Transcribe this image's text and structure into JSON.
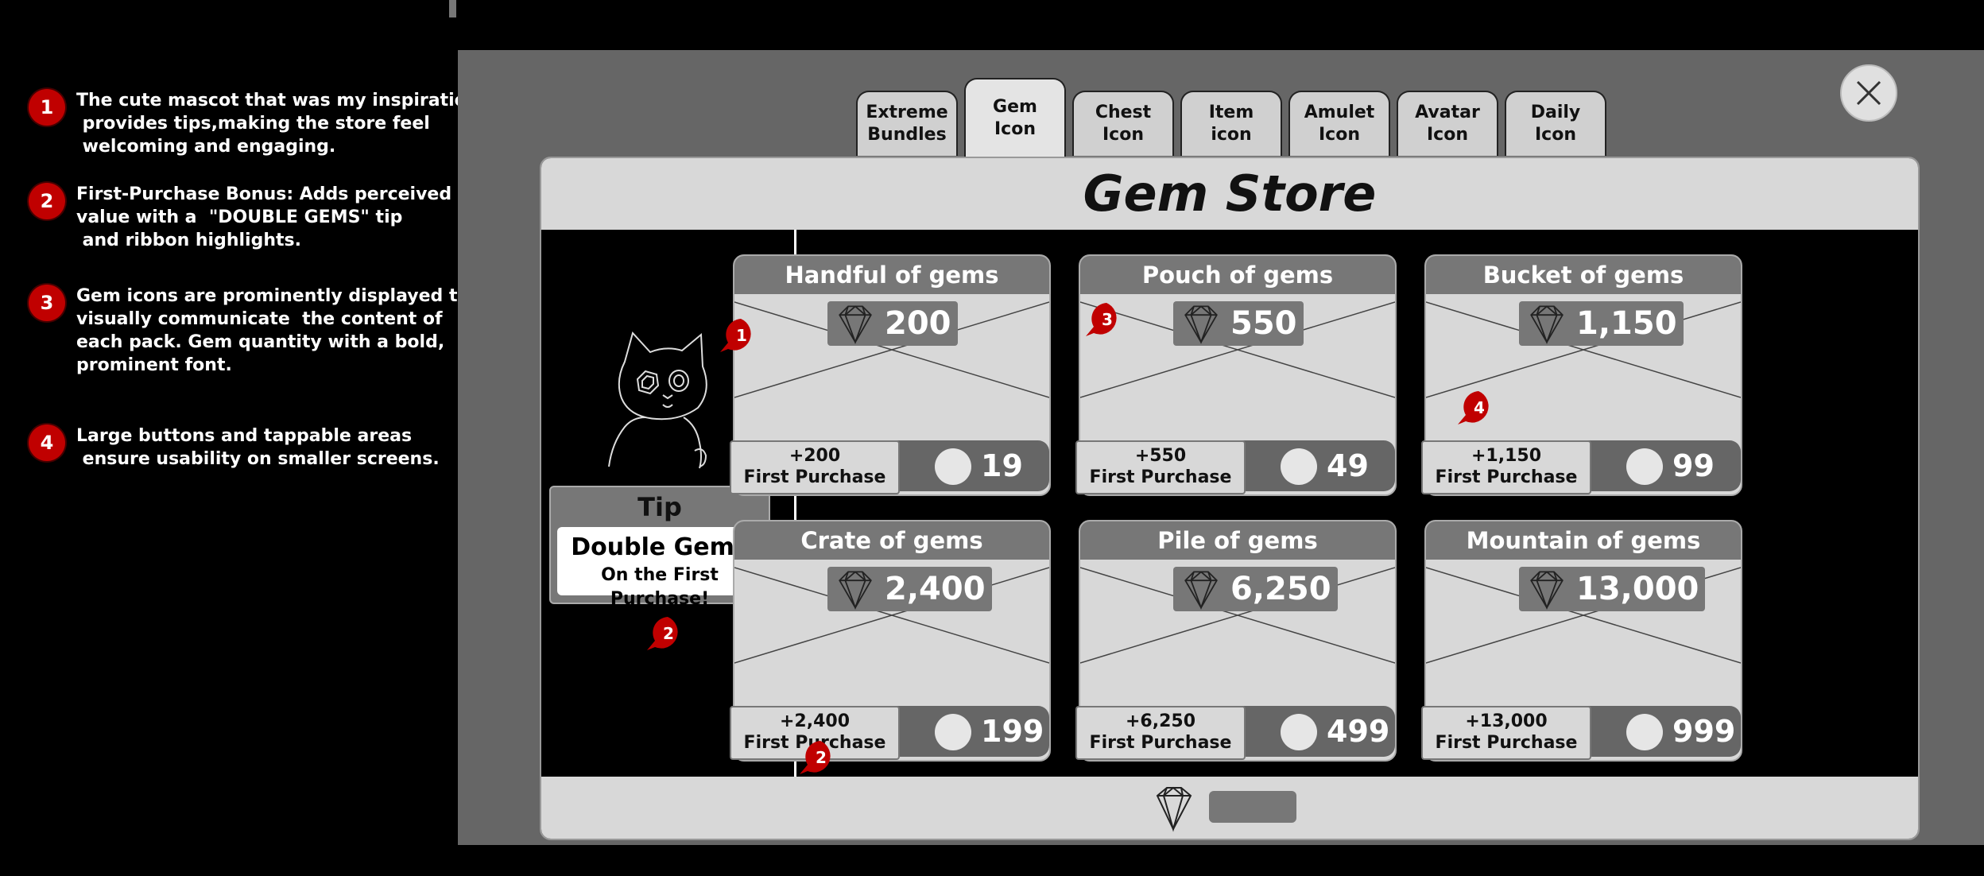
{
  "annotations": [
    {
      "num": "1",
      "text": "The cute mascot that was my inspiration,\n provides tips,making the store feel\n welcoming and engaging."
    },
    {
      "num": "2",
      "text": "First-Purchase Bonus: Adds perceived\nvalue with a  \"DOUBLE GEMS\" tip\n and ribbon highlights."
    },
    {
      "num": "3",
      "text": "Gem icons are prominently displayed to\nvisually communicate  the content of\neach pack. Gem quantity with a bold,\nprominent font."
    },
    {
      "num": "4",
      "text": "Large buttons and tappable areas\n ensure usability on smaller screens."
    }
  ],
  "tabs": [
    {
      "label": "Extreme\nBundles",
      "active": false
    },
    {
      "label": "Gem\nIcon",
      "active": true
    },
    {
      "label": "Chest\nIcon",
      "active": false
    },
    {
      "label": "Item\nicon",
      "active": false
    },
    {
      "label": "Amulet\nIcon",
      "active": false
    },
    {
      "label": "Avatar\nIcon",
      "active": false
    },
    {
      "label": "Daily\nIcon",
      "active": false
    }
  ],
  "store": {
    "title": "Gem Store"
  },
  "tip": {
    "title": "Tip",
    "line1": "Double  Gems",
    "line2": "On the First Purchase!"
  },
  "packs": [
    {
      "name": "Handful of gems",
      "gems": "200",
      "bonus": "+200",
      "bonus_label": "First Purchase",
      "price": "19"
    },
    {
      "name": "Pouch of gems",
      "gems": "550",
      "bonus": "+550",
      "bonus_label": "First Purchase",
      "price": "49"
    },
    {
      "name": "Bucket of gems",
      "gems": "1,150",
      "bonus": "+1,150",
      "bonus_label": "First Purchase",
      "price": "99"
    },
    {
      "name": "Crate of gems",
      "gems": "2,400",
      "bonus": "+2,400",
      "bonus_label": "First Purchase",
      "price": "199"
    },
    {
      "name": "Pile of gems",
      "gems": "6,250",
      "bonus": "+6,250",
      "bonus_label": "First Purchase",
      "price": "499"
    },
    {
      "name": "Mountain of gems",
      "gems": "13,000",
      "bonus": "+13,000",
      "bonus_label": "First Purchase",
      "price": "999"
    }
  ],
  "markers": [
    "1",
    "2",
    "3",
    "4",
    "2"
  ],
  "colors": {
    "accent_red": "#c00000",
    "panel_gray": "#666666",
    "card_gray": "#d8d8d8"
  }
}
